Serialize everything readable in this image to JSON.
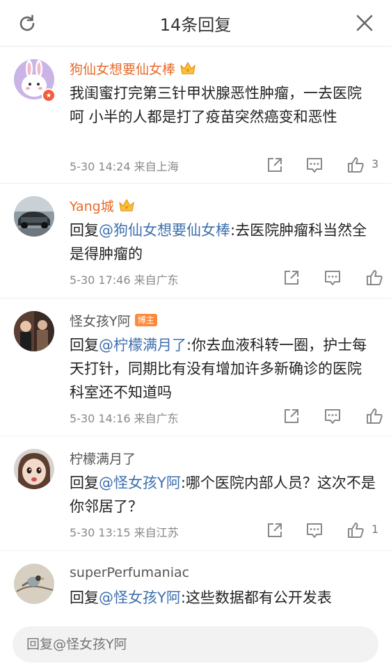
{
  "header": {
    "title": "14条回复"
  },
  "comments": [
    {
      "username": "狗仙女想要仙女棒",
      "text": "我闺蜜打完第三针甲状腺恶性肿瘤，一去医院 呵 小半的人都是打了疫苗突然癌变和恶性",
      "meta": "5-30 14:24 来自上海",
      "likes": "3"
    },
    {
      "username": "Yang城",
      "reply_prefix": "回复",
      "mention": "@狗仙女想要仙女棒",
      "text": ":去医院肿瘤科当然全是得肿瘤的",
      "meta": "5-30 17:46 来自广东",
      "likes": ""
    },
    {
      "username": "怪女孩Y阿",
      "tag": "博主",
      "reply_prefix": "回复",
      "mention": "@柠檬满月了",
      "text": ":你去血液科转一圈，护士每天打针，同期比有没有增加许多新确诊的医院科室还不知道吗",
      "meta": "5-30 14:16 来自广东",
      "likes": ""
    },
    {
      "username": "柠檬满月了",
      "reply_prefix": "回复",
      "mention": "@怪女孩Y阿",
      "text": ":哪个医院内部人员？这次不是你邻居了？",
      "meta": "5-30 13:15 来自江苏",
      "likes": "1"
    },
    {
      "username": "superPerfumaniac",
      "reply_prefix": "回复",
      "mention": "@怪女孩Y阿",
      "text": ":这些数据都有公开发表",
      "meta": "",
      "likes": ""
    }
  ],
  "reply_input": {
    "placeholder": "回复@怪女孩Y阿"
  },
  "colors": {
    "mention": "#3d6fae",
    "vip_name": "#e86a2a",
    "tag": "#ff8a3d"
  },
  "icons": [
    "refresh-icon",
    "close-icon",
    "share-icon",
    "comment-icon",
    "like-icon",
    "crown-icon"
  ]
}
